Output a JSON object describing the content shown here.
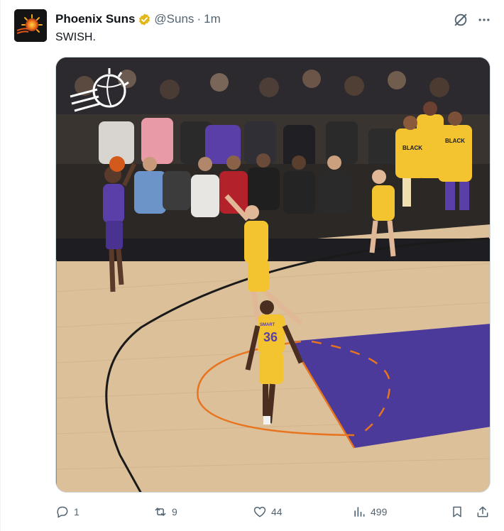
{
  "author": {
    "name": "Phoenix Suns",
    "handle": "@Suns",
    "separator": "·",
    "time": "1m",
    "verified_color": "#e2b719"
  },
  "tweet": {
    "text": "SWISH."
  },
  "media": {
    "jersey_number": "36",
    "jersey_name": "SMART",
    "bench_shirt_text": "BLACK HISTORY"
  },
  "actions": {
    "replies": "1",
    "reposts": "9",
    "likes": "44",
    "views": "499"
  },
  "colors": {
    "text_secondary": "#536471",
    "court_wood": "#dcc09a",
    "paint_purple": "#4b3a9a",
    "court_orange": "#e8741f",
    "lakers_gold": "#f4c430"
  },
  "icons": [
    "suns-logo-icon",
    "verified-badge-icon",
    "grok-icon",
    "more-icon",
    "reply-icon",
    "repost-icon",
    "like-icon",
    "views-icon",
    "bookmark-icon",
    "share-icon"
  ]
}
